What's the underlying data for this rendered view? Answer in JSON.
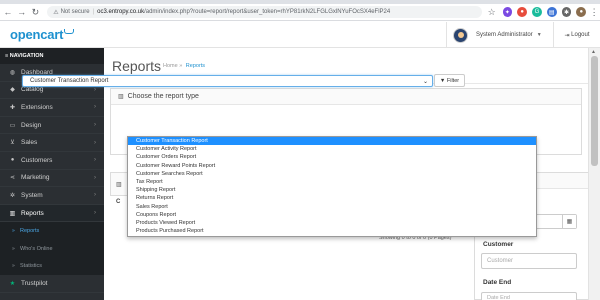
{
  "browser": {
    "url_warning_icon": "warning-icon",
    "not_secure": "Not secure",
    "url_host": "oc3.entropy.co.uk",
    "url_path": "/admin/index.php?route=report/report&user_token=rhYP81rkN2LFGLGxlNYuFOcSX4eFlP24"
  },
  "header": {
    "logo": "opencart",
    "username": "System Administrator",
    "logout": "Logout"
  },
  "sidebar": {
    "title": "NAVIGATION",
    "items": [
      {
        "label": "Dashboard",
        "icon": "dashboard-icon"
      },
      {
        "label": "Catalog",
        "icon": "tag-icon"
      },
      {
        "label": "Extensions",
        "icon": "puzzle-icon"
      },
      {
        "label": "Design",
        "icon": "monitor-icon"
      },
      {
        "label": "Sales",
        "icon": "cart-icon"
      },
      {
        "label": "Customers",
        "icon": "user-icon"
      },
      {
        "label": "Marketing",
        "icon": "share-icon"
      },
      {
        "label": "System",
        "icon": "gear-icon"
      },
      {
        "label": "Reports",
        "icon": "bar-chart-icon"
      }
    ],
    "sub_items": [
      {
        "label": "Reports"
      },
      {
        "label": "Who's Online"
      },
      {
        "label": "Statistics"
      }
    ],
    "trustpilot": "Trustpilot"
  },
  "main": {
    "title": "Reports",
    "breadcrumb_home": "Home",
    "breadcrumb_sep": "»",
    "breadcrumb_current": "Reports",
    "panel_title": "Choose the report type",
    "selected_report": "Customer Transaction Report",
    "filter_label": "Filter",
    "column_partial": "C",
    "showing": "Showing 0 to 0 of 0 (0 Pages)"
  },
  "dropdown": {
    "options": [
      "Customer Transaction Report",
      "Customer Activity Report",
      "Customer Orders Report",
      "Customer Reward Points Report",
      "Customer Searches Report",
      "Tax Report",
      "Shipping Report",
      "Returns Report",
      "Sales Report",
      "Coupons Report",
      "Products Viewed Report",
      "Products Purchased Report"
    ]
  },
  "filter_panel": {
    "customer_label": "Customer",
    "customer_placeholder": "Customer",
    "date_end_label": "Date End",
    "date_end_placeholder": "Date End"
  },
  "colors": {
    "accent": "#1e91cf",
    "sidebar_bg": "#2b2f33",
    "selected_option": "#1e90ff"
  }
}
